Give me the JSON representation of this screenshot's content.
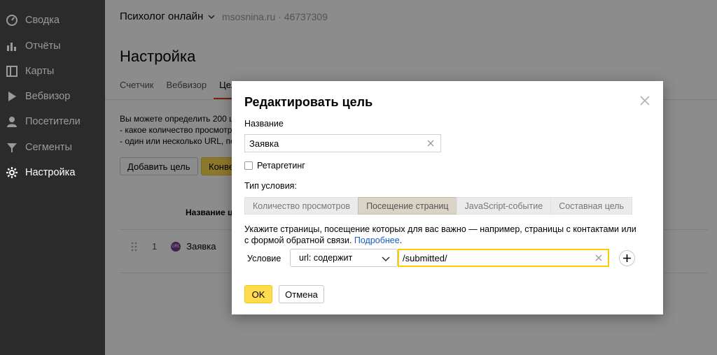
{
  "sidebar": {
    "items": [
      {
        "label": "Сводка",
        "icon": "dashboard-icon"
      },
      {
        "label": "Отчёты",
        "icon": "bar-chart-icon"
      },
      {
        "label": "Карты",
        "icon": "map-icon"
      },
      {
        "label": "Вебвизор",
        "icon": "play-icon"
      },
      {
        "label": "Посетители",
        "icon": "user-icon"
      },
      {
        "label": "Сегменты",
        "icon": "filter-icon"
      },
      {
        "label": "Настройка",
        "icon": "gear-icon"
      }
    ]
  },
  "header": {
    "counter_name": "Психолог онлайн",
    "counter_meta": "msosnina.ru · 46737309"
  },
  "page": {
    "title": "Настройка",
    "tabs": [
      "Счетчик",
      "Вебвизор",
      "Цел"
    ],
    "info_lines": [
      "Вы можете определить 200 ц",
      "- какое количество просмотр",
      "- один или несколько URL, по"
    ],
    "add_goal_label": "Добавить цель",
    "conversion_label": "Конве",
    "goal_column_header": "Название ц",
    "goal_row": {
      "index": "1",
      "badge": "URL",
      "name": "Заявка"
    }
  },
  "modal": {
    "title": "Редактировать цель",
    "name_label": "Название",
    "name_value": "Заявка",
    "retargeting_label": "Ретаргетинг",
    "condition_type_label": "Тип условия:",
    "condition_types": [
      "Количество просмотров",
      "Посещение страниц",
      "JavaScript-событие",
      "Составная цель"
    ],
    "active_condition_type": 1,
    "hint_text": "Укажите страницы, посещение которых для вас важно — например, страницы с контактами или с формой обратной связи.",
    "hint_link": "Подробнее",
    "condition_label": "Условие",
    "condition_select": "url: содержит",
    "condition_value": "/submitted/",
    "ok_label": "OK",
    "cancel_label": "Отмена"
  },
  "colors": {
    "sidebar_bg": "#2b2b2b",
    "accent_yellow": "#ffdb4d",
    "focus_border": "#ffcc00",
    "link": "#1a5cc2",
    "tab_underline": "#e03b1c"
  }
}
